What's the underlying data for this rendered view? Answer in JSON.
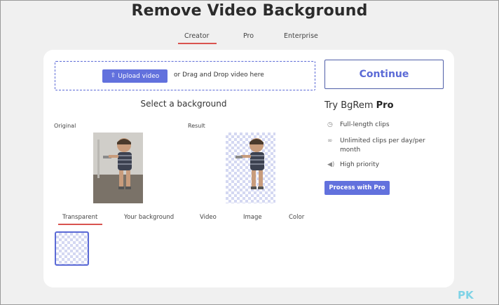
{
  "page": {
    "title": "Remove Video Background"
  },
  "plan_tabs": [
    {
      "label": "Creator",
      "active": true
    },
    {
      "label": "Pro"
    },
    {
      "label": "Enterprise"
    }
  ],
  "upload": {
    "button_label": "Upload video",
    "drop_text": "or Drag and Drop video here",
    "icon": "upload-icon"
  },
  "preview": {
    "section_title": "Select a background",
    "original_label": "Original",
    "result_label": "Result"
  },
  "background_tabs": [
    {
      "label": "Transparent",
      "active": true
    },
    {
      "label": "Your background"
    },
    {
      "label": "Video"
    },
    {
      "label": "Image"
    },
    {
      "label": "Color"
    }
  ],
  "sidebar": {
    "continue_label": "Continue",
    "promo_prefix": "Try BgRem ",
    "promo_bold": "Pro",
    "features": [
      {
        "icon": "clock-icon",
        "text": "Full-length clips"
      },
      {
        "icon": "infinity-icon",
        "text": "Unlimited clips per day/per month"
      },
      {
        "icon": "speaker-icon",
        "text": "High priority"
      }
    ],
    "process_label": "Process with Pro"
  },
  "watermark": {
    "text": "PK"
  },
  "colors": {
    "accent": "#6271dd",
    "tab_underline": "#d9534f",
    "background": "#f0f0f0",
    "card": "#ffffff"
  }
}
